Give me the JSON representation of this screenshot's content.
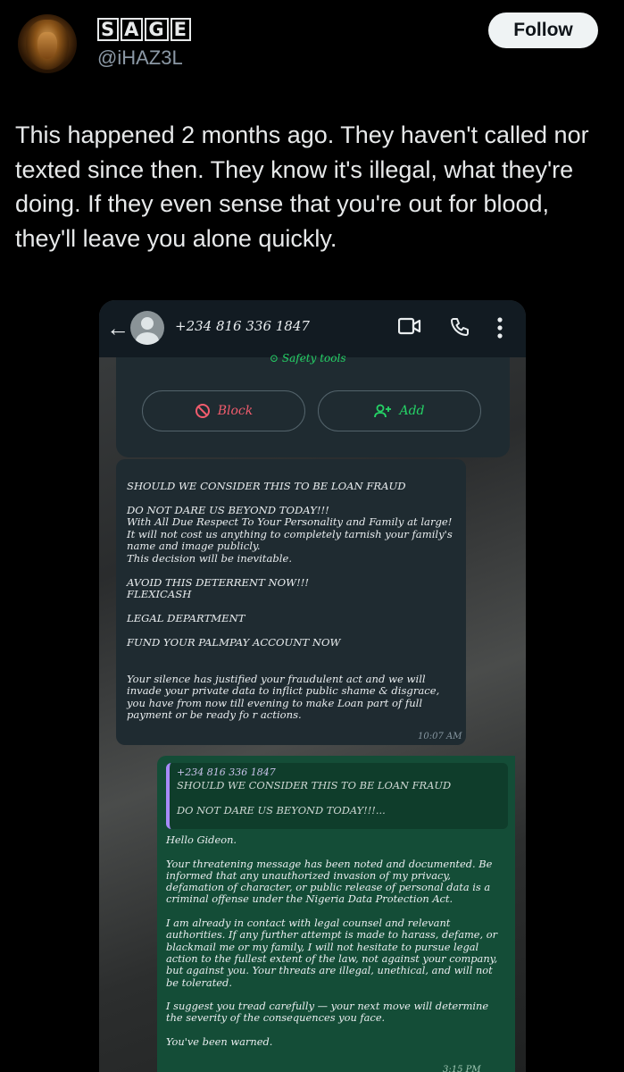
{
  "tweet": {
    "display_name_letters": [
      "S",
      "A",
      "G",
      "E"
    ],
    "handle": "@iHAZ3L",
    "follow_label": "Follow",
    "text": "This happened 2 months ago. They haven't called nor texted since then. They know it's illegal, what they're doing. If they even sense that you're out for blood, they'll leave you alone quickly."
  },
  "whatsapp": {
    "contact_number": "+234 816 336 1847",
    "icons": [
      "back-arrow-icon",
      "video-call-icon",
      "phone-icon",
      "more-options-icon"
    ],
    "safety_tools_label": "Safety tools",
    "block_label": "Block",
    "add_label": "Add",
    "incoming_message": "SHOULD WE CONSIDER THIS TO BE LOAN FRAUD\n\nDO NOT DARE US BEYOND TODAY!!!\nWith All Due Respect To Your Personality and Family at large!\nIt will not cost us anything to completely tarnish your family's name and image publicly.\nThis decision will be inevitable.\n\n AVOID THIS DETERRENT NOW!!!\nFLEXICASH\n\n LEGAL DEPARTMENT\n\nFUND YOUR PALMPAY ACCOUNT NOW\n\n\nYour silence has justified your fraudulent act and we will invade your private data to inflict public shame & disgrace, you have from now till evening to make Loan part of full payment or be ready fo r actions.",
    "incoming_time": "10:07 AM",
    "quoted_sender": "+234 816 336 1847",
    "quoted_line1": "SHOULD WE CONSIDER THIS TO BE LOAN FRAUD",
    "quoted_line2": "DO NOT DARE US BEYOND TODAY!!!...",
    "reply_message": "Hello Gideon.\n\nYour threatening message has been noted and documented. Be informed that any unauthorized invasion of my privacy, defamation of character, or public release of personal data is a criminal offense under the Nigeria Data Protection Act.\n\nI am already in contact with legal counsel and relevant authorities. If any further attempt is made to harass, defame, or blackmail me or my family, I will not hesitate to pursue legal action to the fullest extent of the law, not against your company, but against you. Your threats are illegal, unethical, and will not be tolerated.\n\nI suggest you tread carefully — your next move will determine the severity of the consequences you face.\n\nYou've been warned.",
    "reply_time": "3:15 PM"
  },
  "colors": {
    "background": "#000000",
    "follow_button": "#eff3f4",
    "whatsapp_green": "#25d366",
    "block_red": "#f15c6d",
    "outgoing_bubble": "#144d37",
    "incoming_bubble": "#1f2b31"
  }
}
